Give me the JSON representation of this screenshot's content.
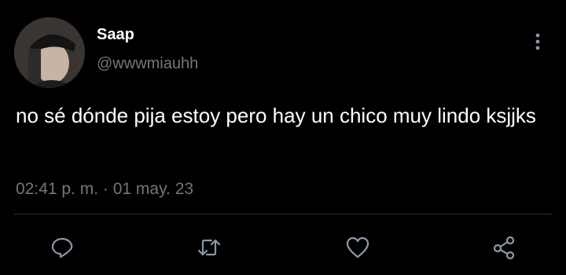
{
  "user": {
    "display_name": "Saap",
    "handle": "@wwwmiauhh"
  },
  "tweet": {
    "text": "no sé dónde pija estoy pero hay un chico muy lindo ksjjks",
    "timestamp": "02:41 p. m. · 01 may. 23"
  },
  "icons": {
    "more": "more-vertical-icon",
    "reply": "reply-icon",
    "retweet": "retweet-icon",
    "like": "heart-icon",
    "share": "share-icon"
  },
  "colors": {
    "background": "#000000",
    "text": "#ffffff",
    "muted": "#71767b",
    "icon": "#8b98a5"
  }
}
